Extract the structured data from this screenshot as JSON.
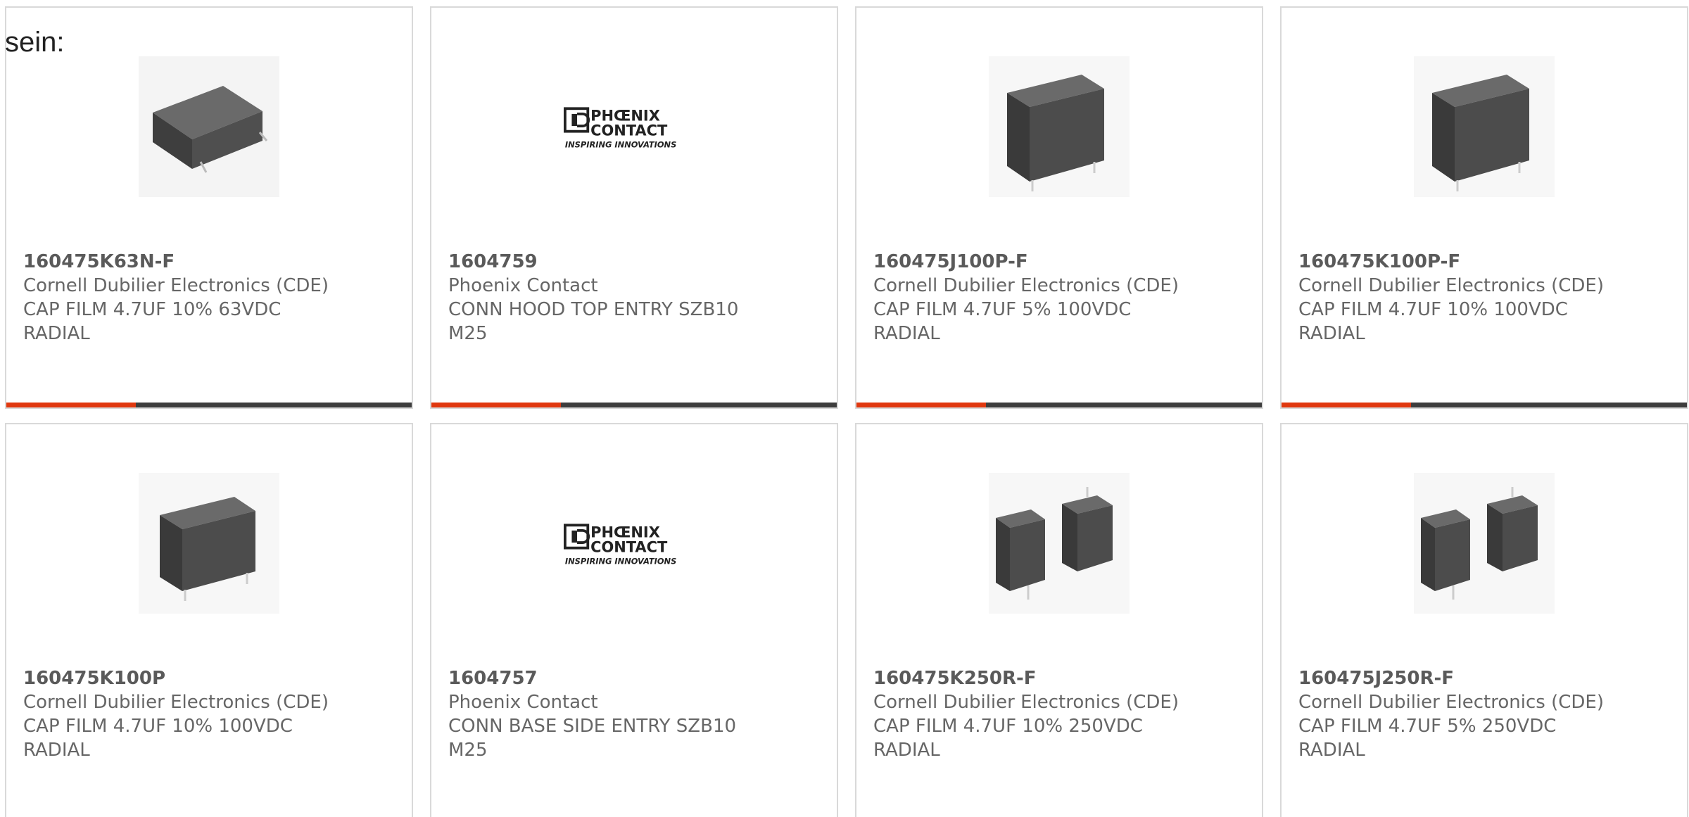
{
  "intro_text": "sein:",
  "colors": {
    "accent": "#e0380f",
    "bar": "#3d3d3d",
    "border": "#d9d9d9",
    "text": "#5a5a5a"
  },
  "products": [
    {
      "part_number": "160475K63N-F",
      "manufacturer": "Cornell Dubilier Electronics (CDE)",
      "description": "CAP FILM 4.7UF 10% 63VDC RADIAL",
      "image": "flat-box-capacitor-image",
      "accent_fraction": 0.32
    },
    {
      "part_number": "1604759",
      "manufacturer": "Phoenix Contact",
      "description": "CONN HOOD TOP ENTRY SZB10 M25",
      "image": "phoenix-contact-logo",
      "logo_line1": "PHŒNIX",
      "logo_line2": "CONTACT",
      "logo_tagline": "INSPIRING INNOVATIONS",
      "accent_fraction": 0.32
    },
    {
      "part_number": "160475J100P-F",
      "manufacturer": "Cornell Dubilier Electronics (CDE)",
      "description": "CAP FILM 4.7UF 5% 100VDC RADIAL",
      "image": "upright-box-capacitor-image",
      "accent_fraction": 0.32
    },
    {
      "part_number": "160475K100P-F",
      "manufacturer": "Cornell Dubilier Electronics (CDE)",
      "description": "CAP FILM 4.7UF 10% 100VDC RADIAL",
      "image": "upright-box-capacitor-image",
      "accent_fraction": 0.32
    },
    {
      "part_number": "160475K100P",
      "manufacturer": "Cornell Dubilier Electronics (CDE)",
      "description": "CAP FILM 4.7UF 10% 100VDC RADIAL",
      "image": "upright-box-capacitor-image"
    },
    {
      "part_number": "1604757",
      "manufacturer": "Phoenix Contact",
      "description": "CONN BASE SIDE ENTRY SZB10 M25",
      "image": "phoenix-contact-logo",
      "logo_line1": "PHŒNIX",
      "logo_line2": "CONTACT",
      "logo_tagline": "INSPIRING INNOVATIONS"
    },
    {
      "part_number": "160475K250R-F",
      "manufacturer": "Cornell Dubilier Electronics (CDE)",
      "description": "CAP FILM 4.7UF 10% 250VDC RADIAL",
      "image": "twin-box-capacitor-image"
    },
    {
      "part_number": "160475J250R-F",
      "manufacturer": "Cornell Dubilier Electronics (CDE)",
      "description": "CAP FILM 4.7UF 5% 250VDC RADIAL",
      "image": "twin-box-capacitor-image"
    }
  ]
}
